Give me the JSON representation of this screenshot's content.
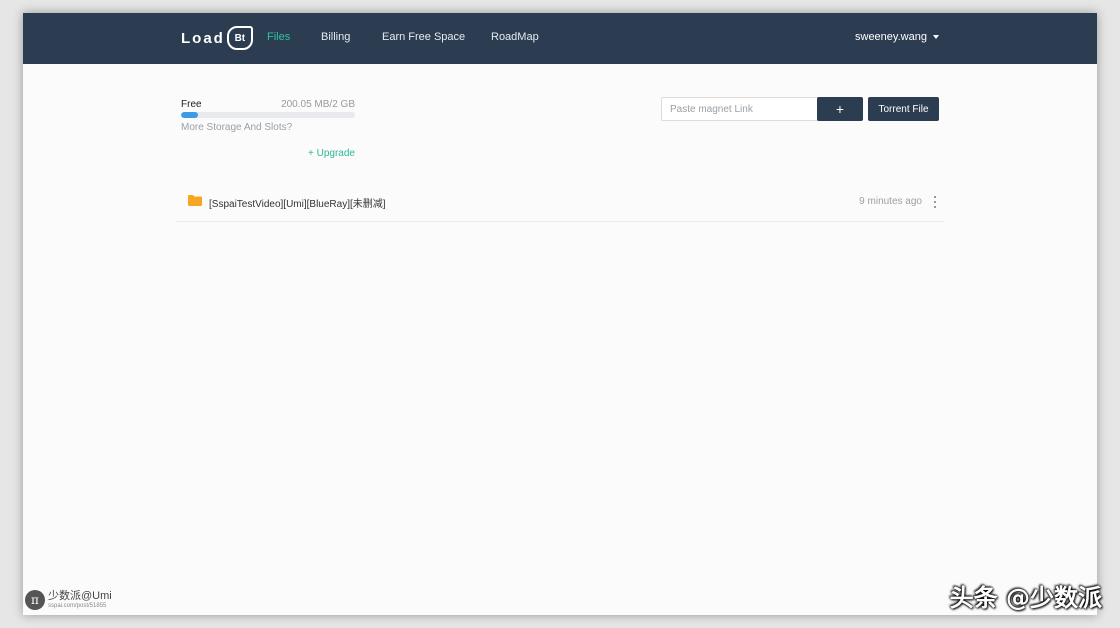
{
  "navbar": {
    "logo_text": "Load",
    "logo_badge": "Bt",
    "links": [
      {
        "label": "Files",
        "active": true
      },
      {
        "label": "Billing",
        "active": false
      },
      {
        "label": "Earn Free Space",
        "active": false
      },
      {
        "label": "RoadMap",
        "active": false
      }
    ],
    "user": "sweeney.wang"
  },
  "storage": {
    "plan_label": "Free",
    "usage": "200.05 MB/2 GB",
    "used_fraction": 0.1,
    "more_link": "More Storage And Slots?",
    "upgrade_link": "+ Upgrade"
  },
  "actions": {
    "magnet_placeholder": "Paste magnet Link",
    "add_label": "+",
    "torrent_label": "Torrent File"
  },
  "files": [
    {
      "name": "[SspaiTestVideo][Umi][BlueRay][未删减]",
      "time": "9 minutes ago",
      "icon": "folder-icon"
    }
  ],
  "colors": {
    "navbar": "#2d3d51",
    "accent": "#2fc2a2",
    "progress": "#3c9ae6",
    "folder": "#f5a623"
  },
  "watermarks": {
    "left_title": "少数派@Umi",
    "left_url": "sspai.com/post/51855",
    "right": "头条 @少数派"
  }
}
